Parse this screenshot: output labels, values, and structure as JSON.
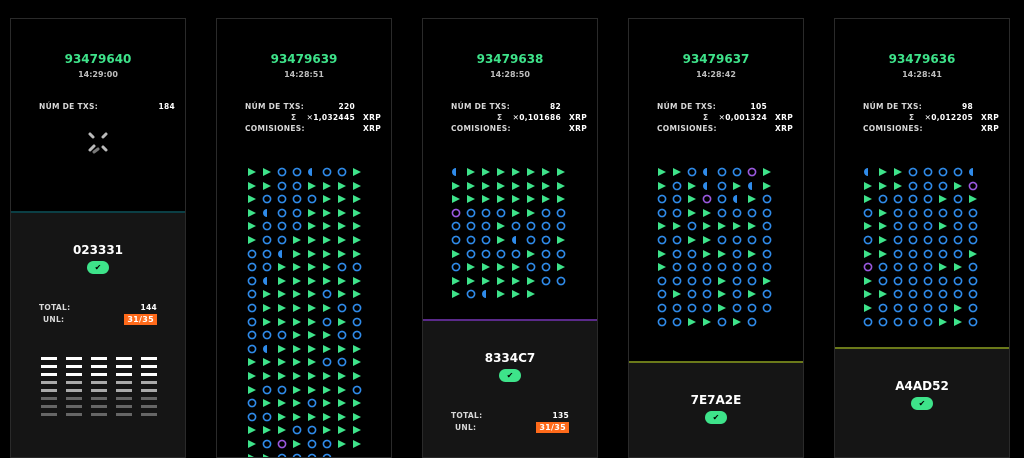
{
  "colors": {
    "green": "#3ee38a",
    "blue": "#2f8bea",
    "purple": "#9b59e0",
    "pink": "#e0245e",
    "dark_green": "#1f4d2e",
    "dark_blue": "#12344f",
    "orange": "#ff6a1a"
  },
  "labels": {
    "num_txs": "NÚM DE TXS:",
    "sigma": "Σ",
    "comisiones": "COMISIONES:",
    "unit": "XRP",
    "total": "TOTAL:",
    "unl": "UNL:",
    "check": "✔"
  },
  "blocks": [
    {
      "hash": "93479640",
      "time": "14:29:00",
      "num_txs": "184",
      "sum": "",
      "fees_unit": "",
      "validation": "023331",
      "total": "144",
      "unl": "31/35"
    },
    {
      "hash": "93479639",
      "time": "14:28:51",
      "num_txs": "220",
      "sum": "1,032445",
      "fees_unit": "XRP",
      "validation": "",
      "total": "",
      "unl": ""
    },
    {
      "hash": "93479638",
      "time": "14:28:50",
      "num_txs": "82",
      "sum": "0,101686",
      "fees_unit": "XRP",
      "validation": "8334C7",
      "total": "135",
      "unl": "31/35"
    },
    {
      "hash": "93479637",
      "time": "14:28:42",
      "num_txs": "105",
      "sum": "0,001324",
      "fees_unit": "XRP",
      "validation": "7E7A2E",
      "total": "",
      "unl": ""
    },
    {
      "hash": "93479636",
      "time": "14:28:41",
      "num_txs": "98",
      "sum": "0,012205",
      "fees_unit": "XRP",
      "validation": "A4AD52",
      "total": "",
      "unl": ""
    }
  ],
  "grids": [
    "",
    "TTOOHOOTTTOOTTTTTOOOOTTTTHOOTTTTTOOOTTTTTOOTTTTTOOHTTTTTOOTTTTOOOHTTTTTTOTTTTOTTOTTTTTOOOTTTTOTOOOOTTTOOOHTTTTTTTTTTTOOTTTTTTTTTTOOTTTTOOTTTOTTTOOTTTTTTTTTOOTTTTOPTOOTTTTOOOO",
    "HTTTTTTTTTTTTTTTTTTTTTTTPOOOTTOOOOOTOOOOOOOTHOOTTOOOOTOOOTTTTOOTTTTTTTOOTOHTTT",
    "TTOHOOPTTOTHOTHTOOTPOHTOOOTTOOOOTTOTTTTOOOTTOOOOTOOTTOTOTOOOOOOOOOOOTOOTOTOOTOTOOOOOTOOOOOTTOTO",
    "HTTOOOOHTTTOOOTPTOOOOTOTOTOOOOOOTTOOOTOOOTOOOOOOTTOOOOOTPOOOOTTOTOOOOOOOTTOOOOOOTOOOOOTOOOOOOTTO"
  ]
}
